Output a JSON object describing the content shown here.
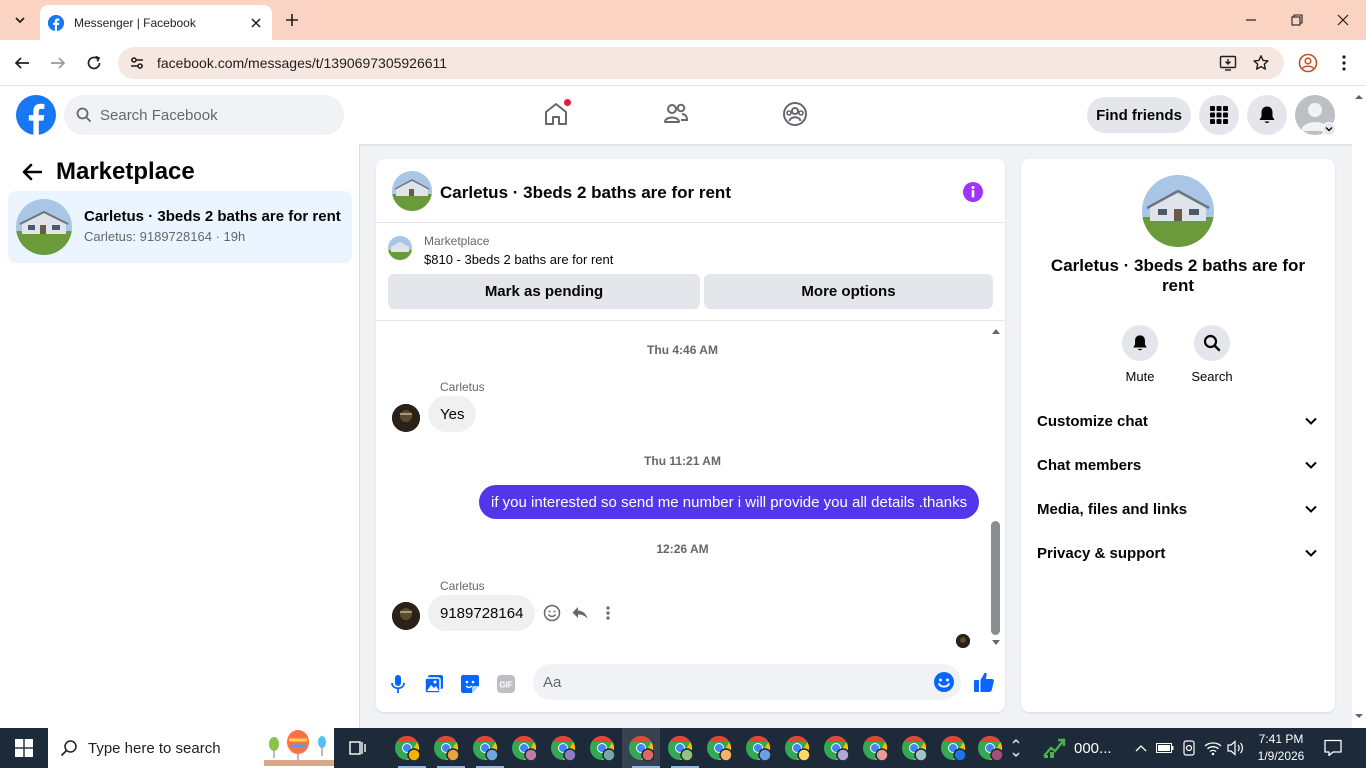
{
  "browser": {
    "tab_title": "Messenger | Facebook",
    "url": "facebook.com/messages/t/1390697305926611"
  },
  "header": {
    "search_placeholder": "Search Facebook",
    "find_friends": "Find friends"
  },
  "left_panel": {
    "title": "Marketplace",
    "conversation": {
      "title": "Carletus · 3beds 2 baths are for rent",
      "subtitle": "Carletus: 9189728164 · 19h"
    }
  },
  "chat": {
    "title": "Carletus · 3beds 2 baths are for rent",
    "marketplace_label": "Marketplace",
    "listing": "$810 - 3beds 2 baths are for rent",
    "mark_pending": "Mark as pending",
    "more_options": "More options",
    "messages": [
      {
        "timestamp": "Thu 4:46 AM",
        "sender": "Carletus",
        "text": "Yes",
        "direction": "in"
      },
      {
        "timestamp": "Thu 11:21 AM",
        "sender": "",
        "text": "if you interested so send me number i will provide you all details .thanks",
        "direction": "out"
      },
      {
        "timestamp": "12:26 AM",
        "sender": "Carletus",
        "text": "9189728164",
        "direction": "in"
      }
    ],
    "composer_placeholder": "Aa",
    "gif_label": "GIF"
  },
  "right_panel": {
    "title": "Carletus · 3beds 2 baths are for rent",
    "actions": [
      "Mute",
      "Search"
    ],
    "sections": [
      "Customize chat",
      "Chat members",
      "Media, files and links",
      "Privacy & support"
    ]
  },
  "taskbar": {
    "search_placeholder": "Type here to search",
    "widget_text": "000...",
    "time": "7:41 PM",
    "date": "1/9/2026"
  },
  "colors": {
    "facebook_blue": "#1877f2",
    "outgoing_bubble": "#5236ea",
    "messenger_purple": "#a033ff",
    "browser_tab_bar": "#fbd3c2",
    "taskbar": "#1c2a3a"
  }
}
